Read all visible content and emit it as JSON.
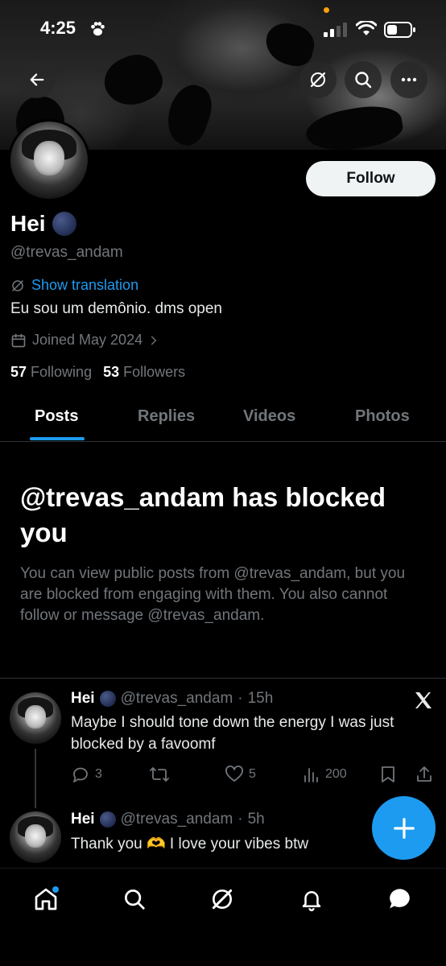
{
  "status_bar": {
    "time": "4:25"
  },
  "profile": {
    "name": "Hei",
    "handle": "@trevas_andam",
    "show_translation": "Show translation",
    "bio": "Eu sou um demônio. dms open",
    "joined": "Joined May 2024",
    "following_count": "57",
    "following_label": "Following",
    "followers_count": "53",
    "followers_label": "Followers",
    "follow_button": "Follow"
  },
  "tabs": [
    {
      "label": "Posts",
      "active": true
    },
    {
      "label": "Replies",
      "active": false
    },
    {
      "label": "Videos",
      "active": false
    },
    {
      "label": "Photos",
      "active": false
    }
  ],
  "blocked": {
    "title": "@trevas_andam has blocked you",
    "description": "You can view public posts from @trevas_andam, but you are blocked from engaging with them. You also cannot follow or message @trevas_andam."
  },
  "posts": [
    {
      "name": "Hei",
      "handle": "@trevas_andam",
      "time": "15h",
      "text": "Maybe I should tone down the energy I was just blocked by a favoomf",
      "replies": "3",
      "likes": "5",
      "views": "200"
    },
    {
      "name": "Hei",
      "handle": "@trevas_andam",
      "time": "5h",
      "text": "Thank you 🫶 I love your vibes btw"
    }
  ],
  "colors": {
    "accent": "#1d9bf0",
    "background": "#000000",
    "muted": "#71767b"
  },
  "icons": {
    "back": "arrow-left-icon",
    "translate": "globe-slash-icon",
    "search": "search-icon",
    "more": "more-horizontal-icon",
    "calendar": "calendar-icon",
    "x_logo": "x-logo-icon",
    "compose": "plus-icon",
    "nav": [
      "home-icon",
      "search-icon",
      "grok-icon",
      "bell-icon",
      "messages-icon"
    ]
  }
}
